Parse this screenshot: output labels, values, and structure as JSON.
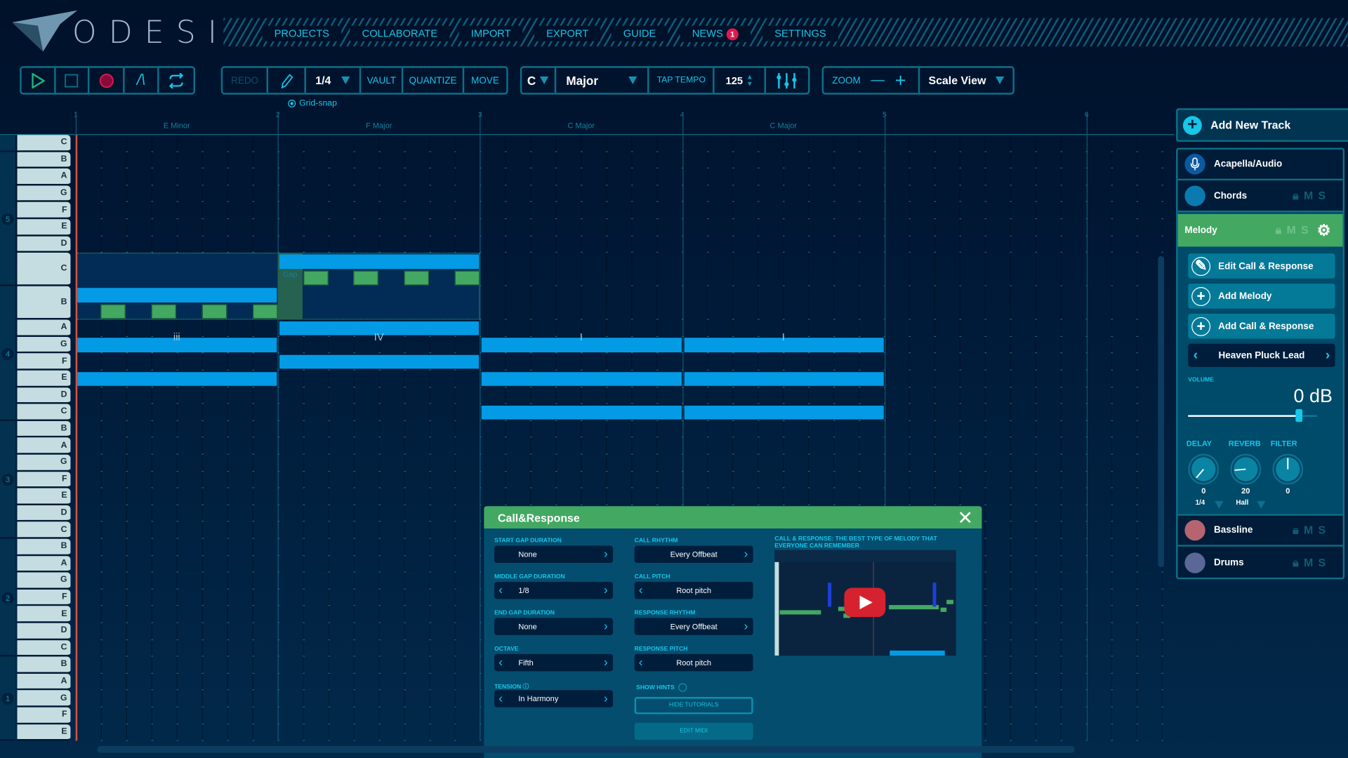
{
  "app": {
    "logo_text": "ODESI"
  },
  "nav": {
    "items": [
      "PROJECTS",
      "COLLABORATE",
      "IMPORT",
      "EXPORT",
      "GUIDE",
      "NEWS",
      "SETTINGS"
    ],
    "news_badge": "1"
  },
  "toolbar": {
    "transport": [
      "play-icon",
      "stop-icon",
      "record-icon",
      "automation-icon",
      "loop-icon"
    ],
    "redo": "REDO",
    "grid_value": "1/4",
    "vault": "VAULT",
    "quantize": "QUANTIZE",
    "move": "MOVE",
    "key": "C",
    "scale": "Major",
    "tap_tempo": "TAP TEMPO",
    "tempo": "125",
    "zoom": "ZOOM",
    "zoom_out": "—",
    "zoom_in": "+",
    "view": "Scale View",
    "grid_snap": "Grid-snap"
  },
  "ruler": {
    "bars": [
      "1",
      "2",
      "3",
      "4",
      "5",
      "6"
    ],
    "chords": [
      "E Minor",
      "F Major",
      "C Major",
      "C Major"
    ]
  },
  "keyboard": {
    "keys": [
      "C",
      "B",
      "A",
      "G",
      "F",
      "E",
      "D",
      "C",
      "B",
      "A",
      "G",
      "F",
      "E",
      "D",
      "C",
      "B",
      "A",
      "G",
      "F",
      "E",
      "D",
      "C",
      "B",
      "A",
      "G",
      "F",
      "E",
      "D",
      "C",
      "B",
      "A",
      "G",
      "F",
      "E"
    ],
    "octaves": [
      "5",
      "4",
      "3",
      "2",
      "1"
    ]
  },
  "roll": {
    "roman": [
      "iii",
      "IV",
      "I",
      "I"
    ],
    "gap_label": "Gap",
    "chord_notes": [
      {
        "bar": 1,
        "pitch": "B4"
      },
      {
        "bar": 1,
        "pitch": "G4"
      },
      {
        "bar": 1,
        "pitch": "E4"
      },
      {
        "bar": 2,
        "pitch": "C5"
      },
      {
        "bar": 2,
        "pitch": "A4"
      },
      {
        "bar": 2,
        "pitch": "F4"
      },
      {
        "bar": 3,
        "pitch": "G4"
      },
      {
        "bar": 3,
        "pitch": "E4"
      },
      {
        "bar": 3,
        "pitch": "C4"
      },
      {
        "bar": 4,
        "pitch": "G4"
      },
      {
        "bar": 4,
        "pitch": "E4"
      },
      {
        "bar": 4,
        "pitch": "C4"
      }
    ],
    "melody_notes": [
      {
        "beat": 1.5,
        "pitch": "B4"
      },
      {
        "beat": 2.5,
        "pitch": "B4"
      },
      {
        "beat": 3.5,
        "pitch": "B4"
      },
      {
        "beat": 4.5,
        "pitch": "B4"
      },
      {
        "beat": 5.5,
        "pitch": "C5"
      },
      {
        "beat": 6.5,
        "pitch": "C5"
      },
      {
        "beat": 7.5,
        "pitch": "C5"
      },
      {
        "beat": 8.5,
        "pitch": "C5"
      }
    ]
  },
  "panel": {
    "add_track": "Add New Track",
    "tracks": {
      "acapella": "Acapella/Audio",
      "chords": "Chords",
      "melody": "Melody",
      "bassline": "Bassline",
      "drums": "Drums"
    },
    "lms": "MS",
    "colors": {
      "chords": "#0a7ab0",
      "bassline": "#b56470",
      "drums": "#5a6797",
      "melody": "#43a862"
    },
    "actions": [
      "Edit Call & Response",
      "Add Melody",
      "Add Call & Response"
    ],
    "instrument": "Heaven Pluck Lead",
    "volume_label": "VOLUME",
    "volume_value": "0 dB",
    "volume_fraction": 0.86,
    "knobs": [
      {
        "label": "DELAY",
        "value": "0",
        "sub": "1/4"
      },
      {
        "label": "REVERB",
        "value": "20",
        "sub": "Hall"
      },
      {
        "label": "FILTER",
        "value": "0",
        "sub": ""
      }
    ]
  },
  "dialog": {
    "title": "Call&Response",
    "fields": [
      {
        "label": "START GAP DURATION",
        "value": "None",
        "left": false
      },
      {
        "label": "MIDDLE GAP DURATION",
        "value": "1/8",
        "left": true
      },
      {
        "label": "END GAP DURATION",
        "value": "None",
        "left": false
      },
      {
        "label": "OCTAVE",
        "value": "Fifth",
        "left": true
      },
      {
        "label": "TENSION ⓘ",
        "value": "In Harmony",
        "left": true
      },
      {
        "label": "CALL RHYTHM",
        "value": "Every Offbeat",
        "left": false
      },
      {
        "label": "CALL PITCH",
        "value": "Root pitch",
        "left": true
      },
      {
        "label": "RESPONSE RHYTHM",
        "value": "Every Offbeat",
        "left": false
      },
      {
        "label": "RESPONSE PITCH",
        "value": "Root pitch",
        "left": true
      }
    ],
    "show_hints": "SHOW HINTS",
    "hide_tutorials": "HIDE TUTORIALS",
    "edit_midi": "EDIT MIDI",
    "video_title": "CALL & RESPONSE: THE BEST TYPE OF MELODY THAT EVERYONE CAN REMEMBER"
  }
}
